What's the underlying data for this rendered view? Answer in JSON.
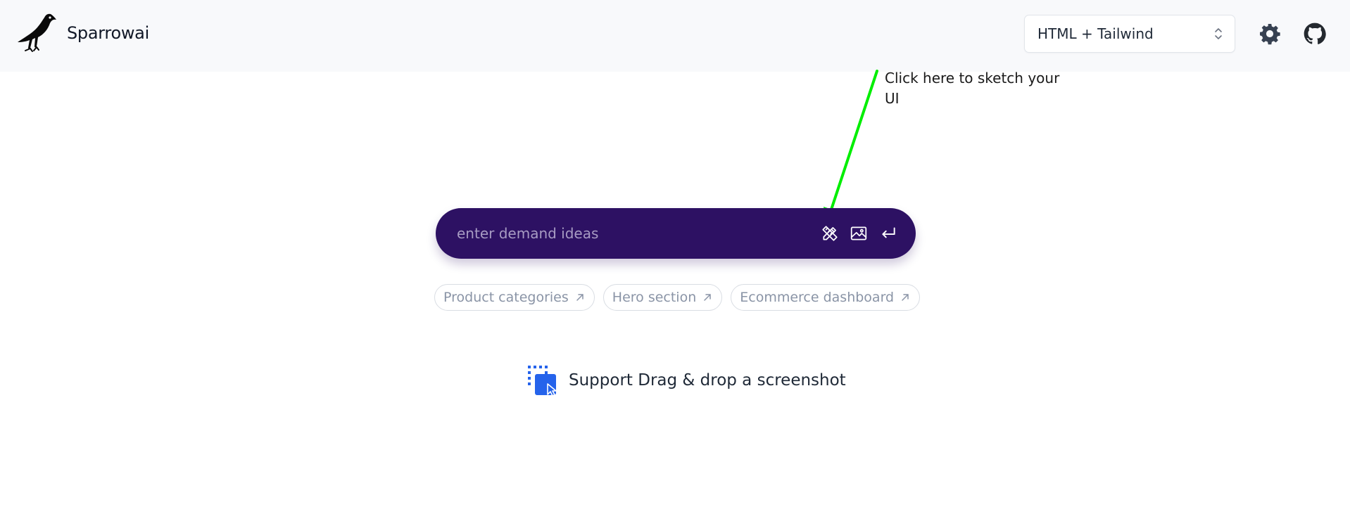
{
  "header": {
    "brand_name": "Sparrowai",
    "logo_icon": "sparrow-bird-icon",
    "framework_select": {
      "value": "HTML + Tailwind",
      "icon": "chevron-up-down-icon"
    },
    "settings_icon": "gear-icon",
    "github_icon": "github-icon"
  },
  "annotation": {
    "text": "Click here to sketch your UI",
    "arrow_color": "#00ee00"
  },
  "prompt": {
    "placeholder": "enter demand ideas",
    "value": "",
    "background_color": "#2d1163",
    "actions": [
      {
        "name": "sketch",
        "icon": "pencil-ruler-icon"
      },
      {
        "name": "upload-image",
        "icon": "image-icon"
      },
      {
        "name": "submit",
        "icon": "enter-arrow-icon"
      }
    ]
  },
  "suggestions": [
    {
      "label": "Product categories",
      "icon": "arrow-up-right-icon"
    },
    {
      "label": "Hero section",
      "icon": "arrow-up-right-icon"
    },
    {
      "label": "Ecommerce dashboard",
      "icon": "arrow-up-right-icon"
    }
  ],
  "dropzone": {
    "text": "Support Drag & drop a screenshot",
    "icon": "drag-drop-icon",
    "icon_color": "#2563eb"
  }
}
